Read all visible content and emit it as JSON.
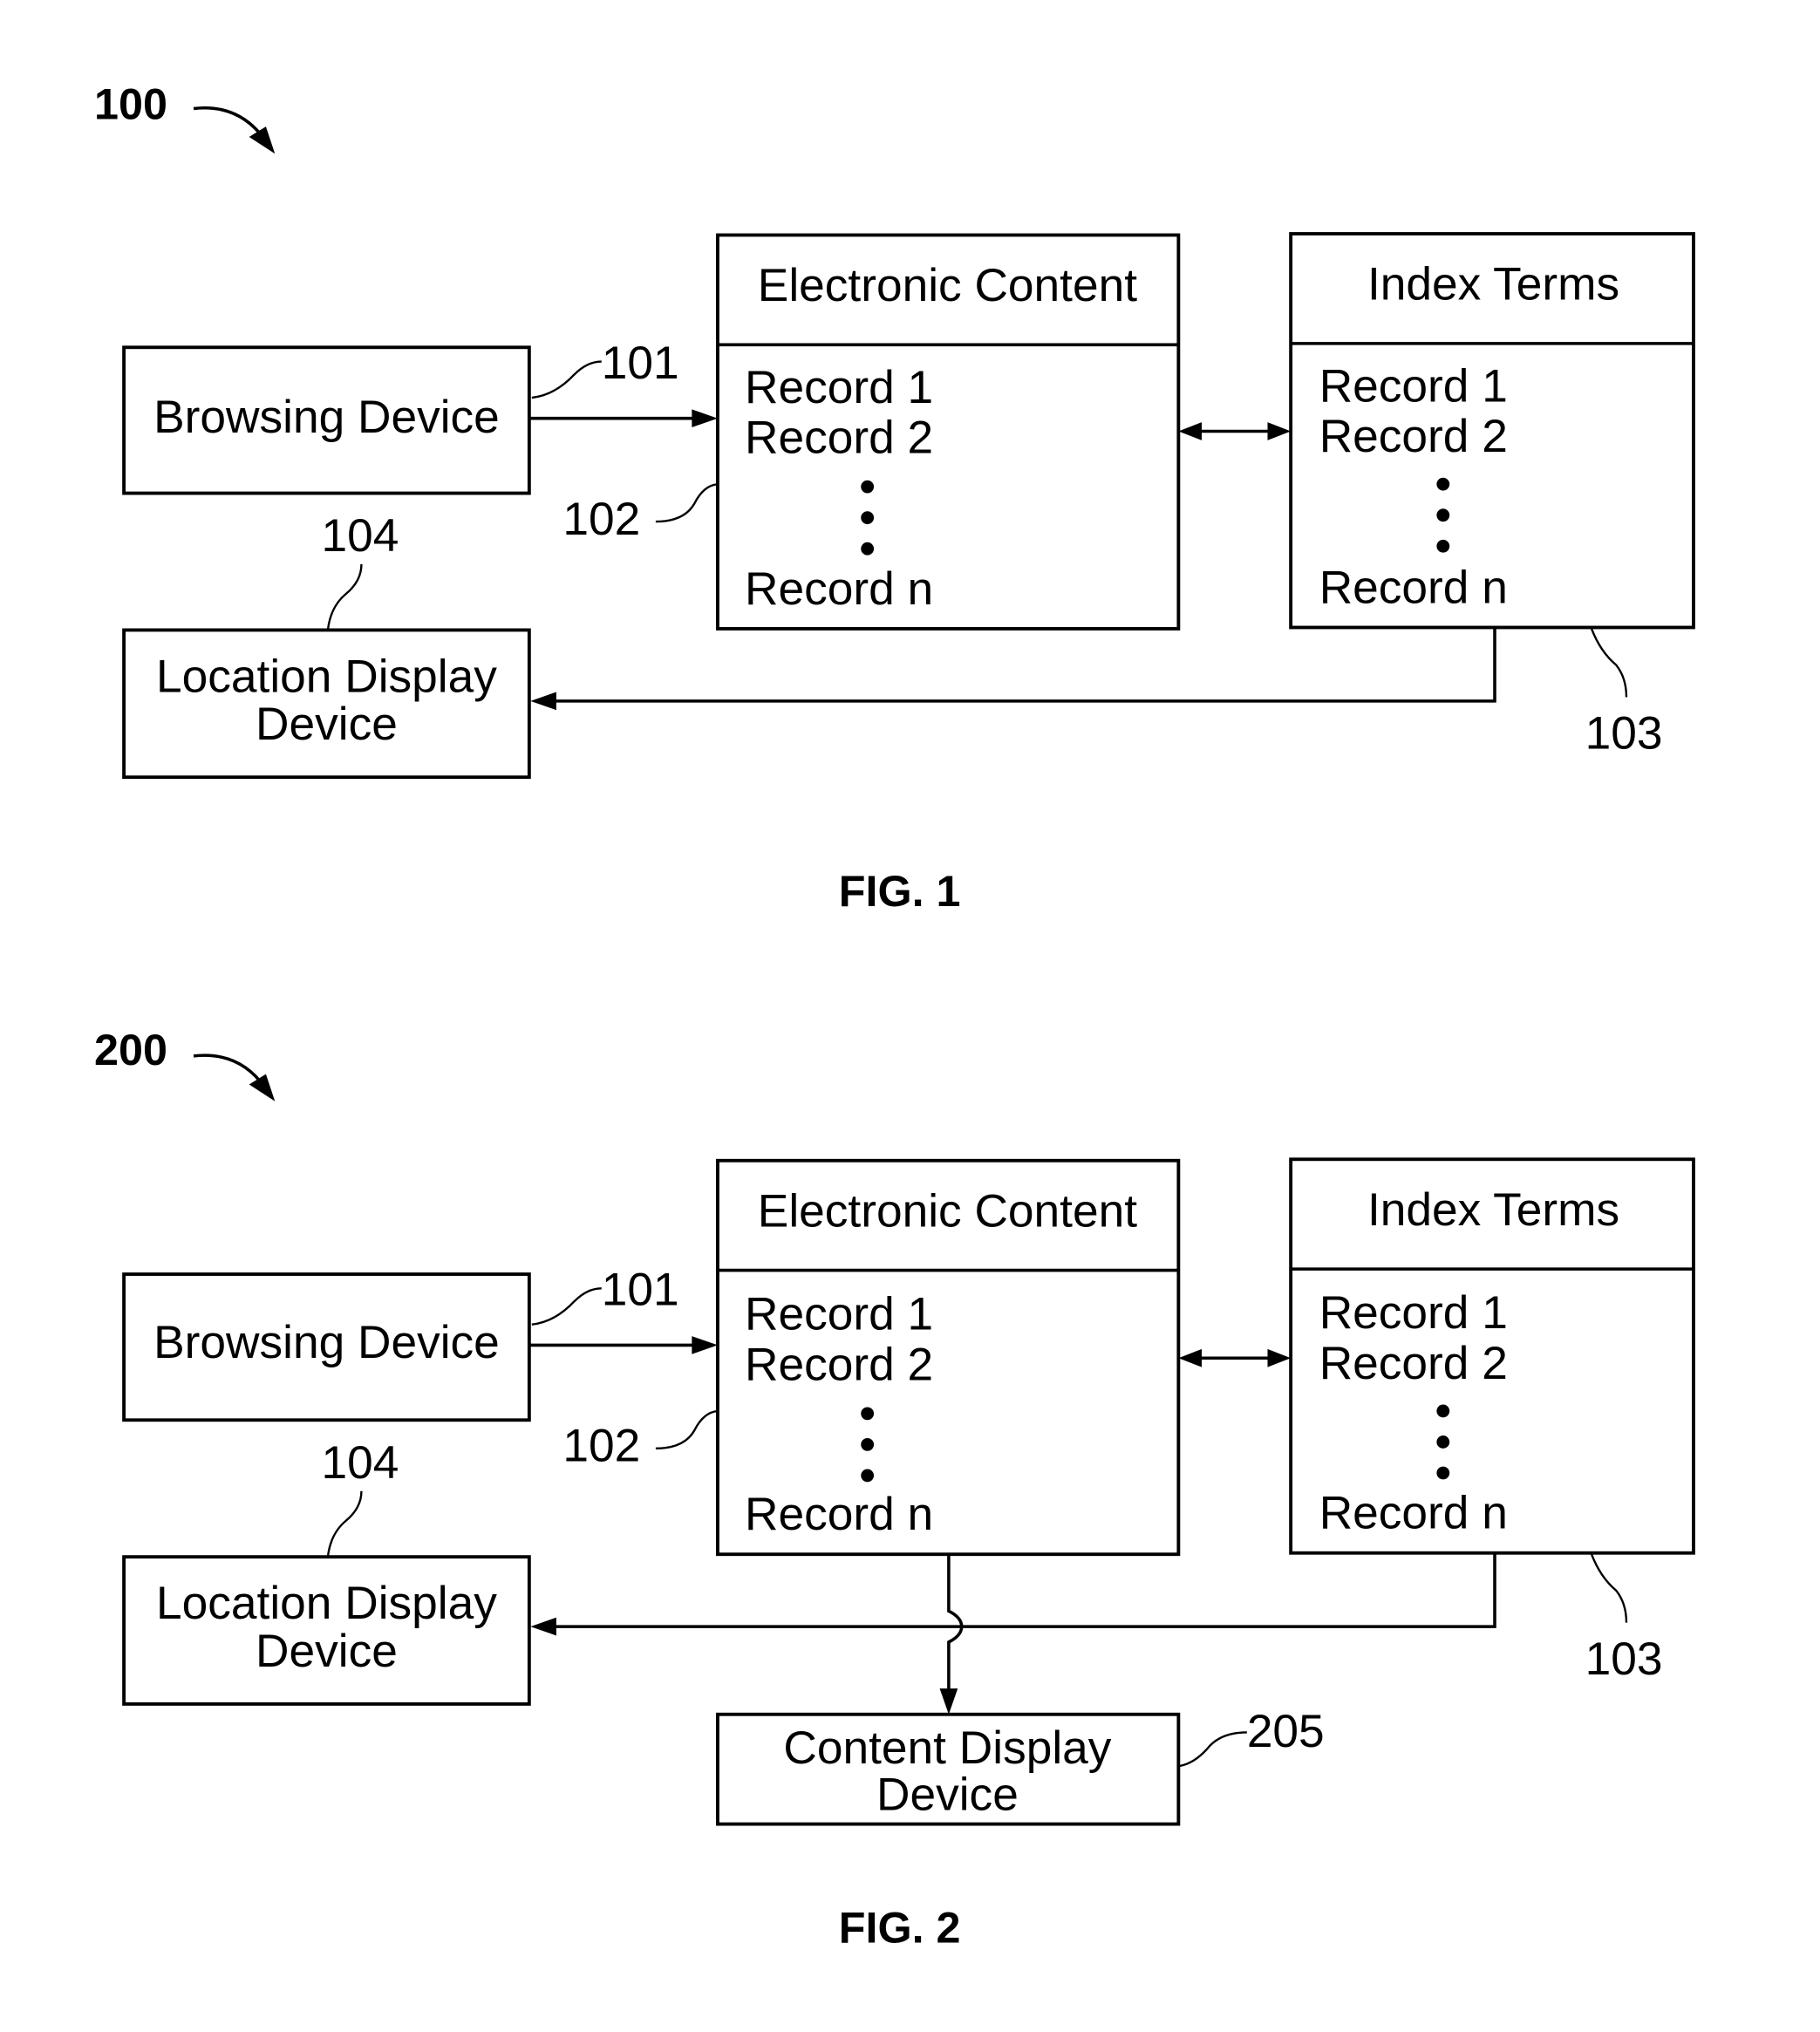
{
  "figures": [
    {
      "ref": "100",
      "caption": "FIG. 1",
      "browsing_device": {
        "label": "Browsing Device",
        "ref": "101"
      },
      "electronic_content": {
        "title": "Electronic Content",
        "records": [
          "Record 1",
          "Record 2",
          "Record n"
        ],
        "ref": "102"
      },
      "index_terms": {
        "title": "Index Terms",
        "records": [
          "Record 1",
          "Record 2",
          "Record n"
        ],
        "ref": "103"
      },
      "location_display": {
        "line1": "Location Display",
        "line2": "Device",
        "ref": "104"
      }
    },
    {
      "ref": "200",
      "caption": "FIG. 2",
      "browsing_device": {
        "label": "Browsing Device",
        "ref": "101"
      },
      "electronic_content": {
        "title": "Electronic Content",
        "records": [
          "Record 1",
          "Record 2",
          "Record n"
        ],
        "ref": "102"
      },
      "index_terms": {
        "title": "Index Terms",
        "records": [
          "Record 1",
          "Record 2",
          "Record n"
        ],
        "ref": "103"
      },
      "location_display": {
        "line1": "Location Display",
        "line2": "Device",
        "ref": "104"
      },
      "content_display": {
        "line1": "Content Display",
        "line2": "Device",
        "ref": "205"
      }
    }
  ]
}
